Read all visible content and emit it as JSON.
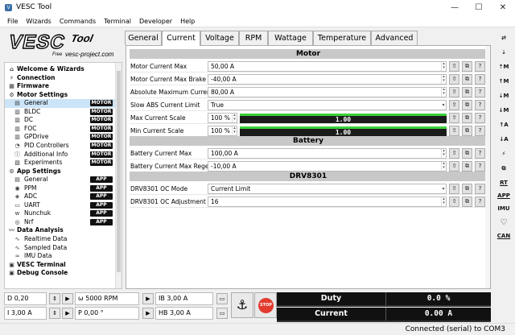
{
  "window": {
    "title": "VESC Tool",
    "min": "—",
    "max": "☐",
    "close": "✕"
  },
  "menu": [
    "File",
    "Wizards",
    "Commands",
    "Terminal",
    "Developer",
    "Help"
  ],
  "logo": {
    "brand": "VESC",
    "word": "Tool",
    "sub": "Free",
    "url": "vesc-project.com"
  },
  "tree": {
    "items": [
      {
        "label": "Welcome & Wizards",
        "section": true,
        "icon": "home-icon",
        "glyph": "⌂"
      },
      {
        "label": "Connection",
        "section": true,
        "icon": "plug-icon",
        "glyph": "⚡"
      },
      {
        "label": "Firmware",
        "section": true,
        "icon": "chip-icon",
        "glyph": "▦"
      },
      {
        "label": "Motor Settings",
        "section": true,
        "icon": "motor-icon",
        "glyph": "⚙"
      },
      {
        "label": "General",
        "badge": "MOTOR",
        "icon": "motor-general-icon",
        "glyph": "▤",
        "selected": true
      },
      {
        "label": "BLDC",
        "badge": "MOTOR",
        "icon": "bldc-icon",
        "glyph": "▥"
      },
      {
        "label": "DC",
        "badge": "MOTOR",
        "icon": "dc-icon",
        "glyph": "▥"
      },
      {
        "label": "FOC",
        "badge": "MOTOR",
        "icon": "foc-icon",
        "glyph": "▥"
      },
      {
        "label": "GPDrive",
        "badge": "MOTOR",
        "icon": "gpdrive-icon",
        "glyph": "▥"
      },
      {
        "label": "PID Controllers",
        "badge": "MOTOR",
        "icon": "pid-icon",
        "glyph": "◔"
      },
      {
        "label": "Additional Info",
        "badge": "MOTOR",
        "icon": "info-icon",
        "glyph": "ⓘ"
      },
      {
        "label": "Experiments",
        "badge": "MOTOR",
        "icon": "experiment-icon",
        "glyph": "▧"
      },
      {
        "label": "App Settings",
        "section": true,
        "icon": "app-icon",
        "glyph": "⚙"
      },
      {
        "label": "General",
        "badge": "APP",
        "icon": "app-general-icon",
        "glyph": "▤"
      },
      {
        "label": "PPM",
        "badge": "APP",
        "icon": "ppm-icon",
        "glyph": "◉"
      },
      {
        "label": "ADC",
        "badge": "APP",
        "icon": "adc-icon",
        "glyph": "◈"
      },
      {
        "label": "UART",
        "badge": "APP",
        "icon": "uart-icon",
        "glyph": "▭"
      },
      {
        "label": "Nunchuk",
        "badge": "APP",
        "icon": "nunchuk-icon",
        "glyph": "ᴡ"
      },
      {
        "label": "Nrf",
        "badge": "APP",
        "icon": "nrf-icon",
        "glyph": "◎"
      },
      {
        "label": "Data Analysis",
        "section": true,
        "icon": "analysis-icon",
        "glyph": "〰"
      },
      {
        "label": "Realtime Data",
        "icon": "realtime-icon",
        "glyph": "∿"
      },
      {
        "label": "Sampled Data",
        "icon": "sampled-icon",
        "glyph": "∿"
      },
      {
        "label": "IMU Data",
        "icon": "imu-data-icon",
        "glyph": "≈"
      },
      {
        "label": "VESC Terminal",
        "section": true,
        "icon": "terminal-icon",
        "glyph": "▣"
      },
      {
        "label": "Debug Console",
        "section": true,
        "icon": "console-icon",
        "glyph": "▣"
      }
    ]
  },
  "tabs": [
    {
      "label": "General"
    },
    {
      "label": "Current",
      "active": true
    },
    {
      "label": "Voltage"
    },
    {
      "label": "RPM"
    },
    {
      "label": "Wattage"
    },
    {
      "label": "Temperature"
    },
    {
      "label": "Advanced"
    }
  ],
  "sections": {
    "motor": "Motor",
    "battery": "Battery",
    "drv": "DRV8301"
  },
  "params": {
    "motor_current_max": {
      "name": "Motor Current Max",
      "value": "50,00 A"
    },
    "motor_current_max_brake": {
      "name": "Motor Current Max Brake",
      "value": "-40,00 A"
    },
    "abs_max_current": {
      "name": "Absolute Maximum Current",
      "value": "80,00 A"
    },
    "slow_abs_current_limit": {
      "name": "Slow ABS Current Limit",
      "value": "True"
    },
    "max_current_scale": {
      "name": "Max Current Scale",
      "pct": "100 %",
      "bar": "1.00",
      "level": 1.0
    },
    "min_current_scale": {
      "name": "Min Current Scale",
      "pct": "100 %",
      "bar": "1.00",
      "level": 1.0
    },
    "battery_current_max": {
      "name": "Battery Current Max",
      "value": "100,00 A"
    },
    "battery_current_max_regen": {
      "name": "Battery Current Max Regen",
      "value": "-10,00 A"
    },
    "drv_oc_mode": {
      "name": "DRV8301 OC Mode",
      "value": "Current Limit"
    },
    "drv_oc_adjustment": {
      "name": "DRV8301 OC Adjustment",
      "value": "16"
    }
  },
  "toolbar_right": [
    "⇄",
    "⇣",
    "⇡M",
    "↑M",
    "⇣M",
    "↓M",
    "↑A",
    "↓A",
    "⚡",
    "⧉",
    "RT",
    "APP",
    "IMU",
    "♡",
    "CAN"
  ],
  "bottom": {
    "duty_input": "D 0,20",
    "current_input": "I 3,00 A",
    "rpm_input": "ω 5000 RPM",
    "pos_input": "P 0,00 °",
    "ib_input": "IB 3,00 A",
    "hb_input": "HB 3,00 A",
    "stop_label": "STOP",
    "duty_label": "Duty",
    "duty_value": "0.0 %",
    "current_label": "Current",
    "current_value": "0.00 A"
  },
  "status": "Connected (serial) to COM3",
  "colors": {
    "bar_fill": "#3bd13b",
    "badge": "#111111",
    "stop": "#e23b2e",
    "selection": "#cce4f7"
  }
}
